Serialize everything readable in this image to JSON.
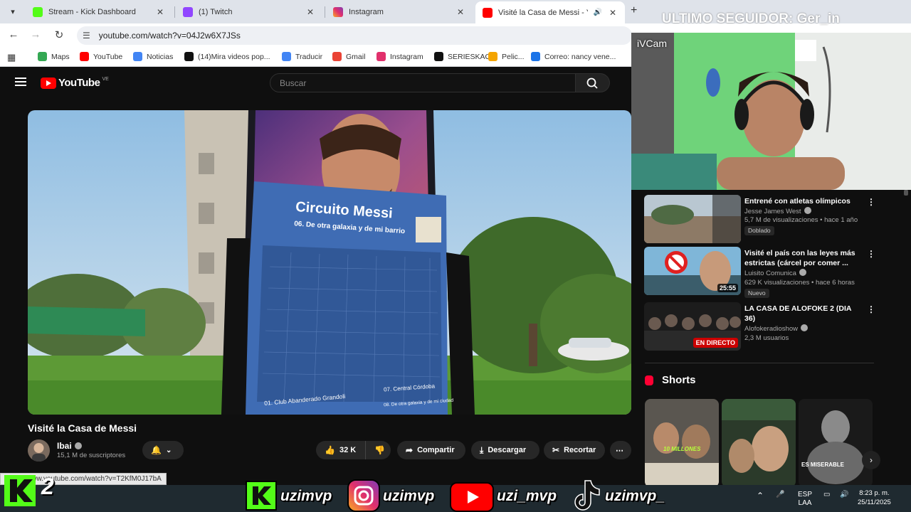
{
  "browser": {
    "tabs": [
      {
        "title": "Stream - Kick Dashboard",
        "color": "#53fc18"
      },
      {
        "title": "(1) Twitch",
        "color": "#9146ff"
      },
      {
        "title": "Instagram",
        "color": "#e1306c"
      },
      {
        "title": "Visité la Casa de Messi - Yo",
        "color": "#ff0000"
      }
    ],
    "url": "youtube.com/watch?v=04J2w6X7JSs",
    "bookmarks": [
      {
        "label": "Maps",
        "color": "#34a853"
      },
      {
        "label": "YouTube",
        "color": "#ff0000"
      },
      {
        "label": "Noticias",
        "color": "#4285f4"
      },
      {
        "label": "(14)Mira videos pop...",
        "color": "#111111"
      },
      {
        "label": "Traducir",
        "color": "#4285f4"
      },
      {
        "label": "Gmail",
        "color": "#ea4335"
      },
      {
        "label": "Instagram",
        "color": "#e1306c"
      },
      {
        "label": "SERIESKAO",
        "color": "#111111"
      },
      {
        "label": "Pelic...",
        "color": "#f4a400"
      },
      {
        "label": "Correo: nancy vene...",
        "color": "#1a73e8"
      }
    ],
    "status_url": "https://www.youtube.com/watch?v=T2KfM0J17bA"
  },
  "youtube": {
    "logo": "YouTube",
    "region": "VE",
    "search_placeholder": "Buscar",
    "video": {
      "title": "Visité la Casa de Messi",
      "sign_title": "Circuito Messi",
      "sign_subtitle": "06. De otra galaxia y de mi barrio",
      "sign_item1": "01. Club Abanderado Grandoli",
      "sign_item2": "07. Central Córdoba",
      "sign_item3": "08. De otra galaxia y de mi ciudad"
    },
    "channel": {
      "name": "Ibai",
      "subs": "15,1 M de suscriptores"
    },
    "actions": {
      "likes": "32 K",
      "share": "Compartir",
      "download": "Descargar",
      "clip": "Recortar"
    },
    "recommendations": [
      {
        "title": "Entrené con atletas olímpicos",
        "channel": "Jesse James West",
        "meta": "5,7 M de visualizaciones • hace 1 año",
        "badge": "Doblado",
        "duration": ""
      },
      {
        "title": "Visité el país con las leyes más estrictas (cárcel por comer ...",
        "channel": "Luisito Comunica",
        "meta": "629 K visualizaciones • hace 6 horas",
        "badge": "Nuevo",
        "duration": "25:55"
      },
      {
        "title": "LA CASA DE ALOFOKE 2 (DIA 36)",
        "channel": "Alofokeradioshow",
        "meta": "2,3 M usuarios",
        "badge": "",
        "duration": "EN DIRECTO"
      }
    ],
    "shorts_label": "Shorts",
    "shorts_captions": [
      "10 MILLONES",
      "",
      "ES MISERABLE"
    ]
  },
  "overlay": {
    "cam_label": "iVCam",
    "follower_text": "ULTIMO SEGUIDOR: Ger_in",
    "socials": [
      "uzimvp",
      "uzimvp",
      "uzi_mvp",
      "uzimvp_"
    ],
    "k2": "2"
  },
  "taskbar": {
    "lang1": "ESP",
    "lang2": "LAA",
    "time": "8:23 p. m.",
    "date": "25/11/2025"
  }
}
